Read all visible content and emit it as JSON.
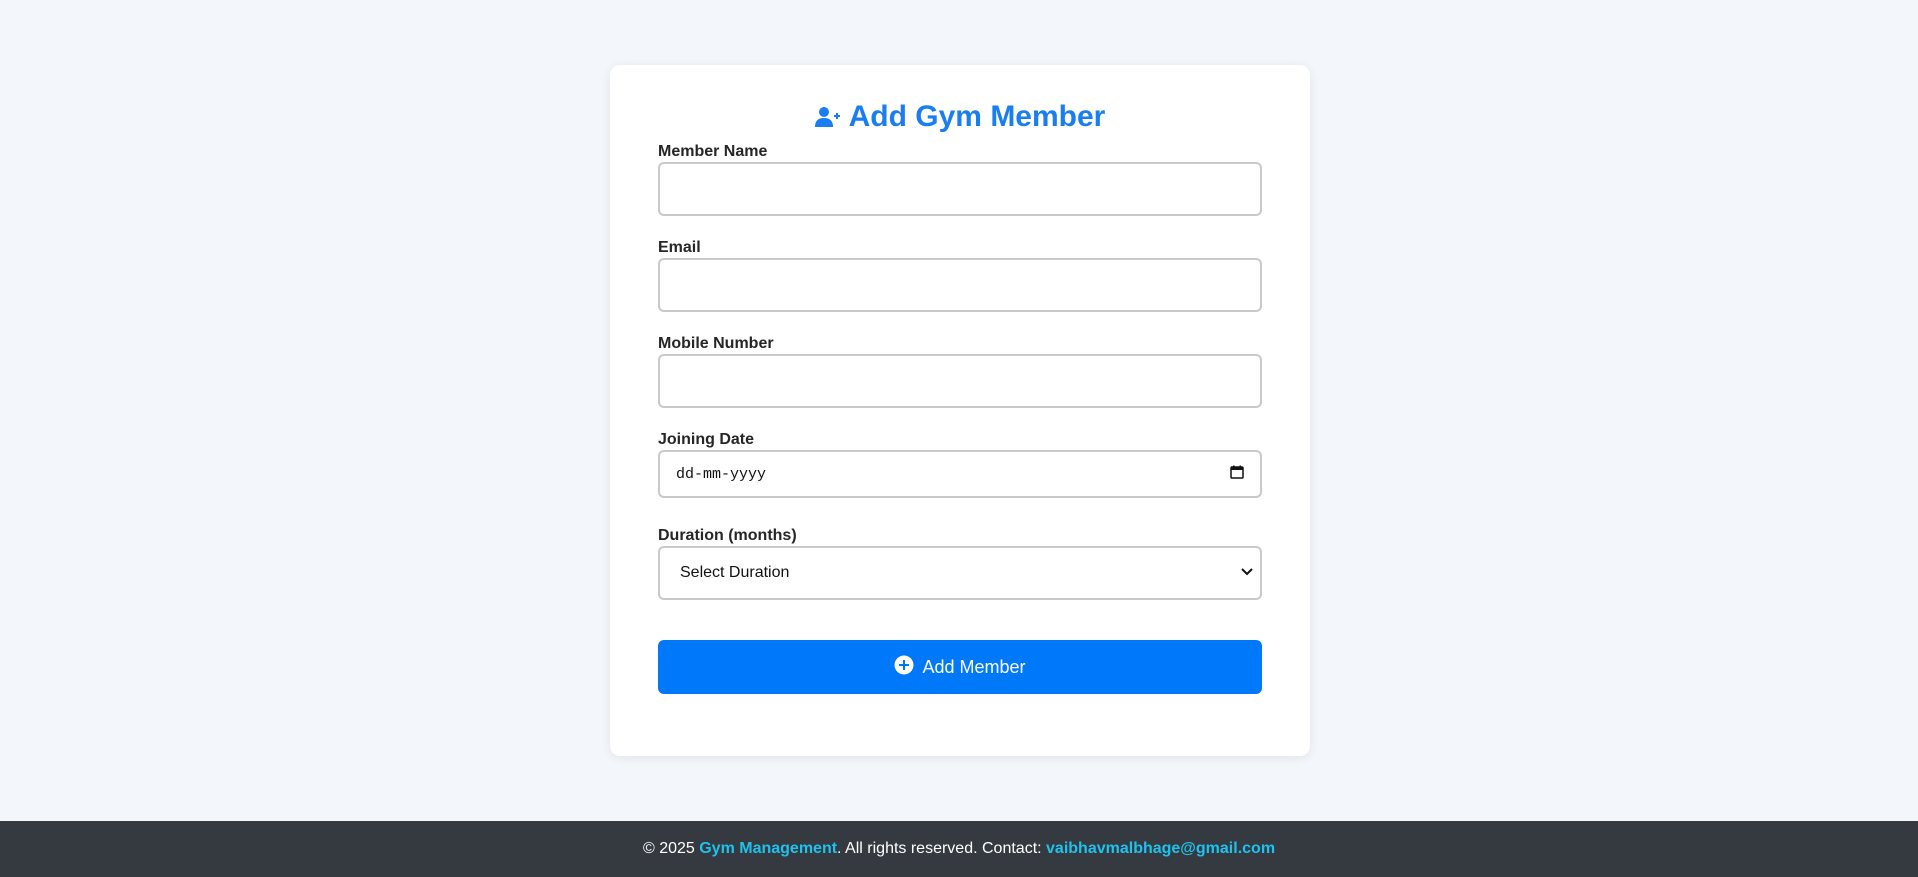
{
  "form": {
    "title": "Add Gym Member",
    "fields": {
      "member_name": {
        "label": "Member Name",
        "value": ""
      },
      "email": {
        "label": "Email",
        "value": ""
      },
      "mobile": {
        "label": "Mobile Number",
        "value": ""
      },
      "joining_date": {
        "label": "Joining Date",
        "placeholder": "dd-mm-yyyy"
      },
      "duration": {
        "label": "Duration (months)",
        "selected": "Select Duration"
      }
    },
    "submit_label": "Add Member"
  },
  "footer": {
    "copyright": "© 2025 ",
    "brand": "Gym Management",
    "rights": ". All rights reserved. Contact: ",
    "email": "vaibhavmalbhage@gmail.com"
  },
  "colors": {
    "accent": "#0078fa",
    "title": "#1a7ef2",
    "footer_bg": "#343a40",
    "footer_link": "#1ec2ef"
  },
  "icons": {
    "title_icon": "user-plus-icon",
    "date_icon": "calendar-icon",
    "select_icon": "chevron-down-icon",
    "button_icon": "plus-circle-icon"
  }
}
